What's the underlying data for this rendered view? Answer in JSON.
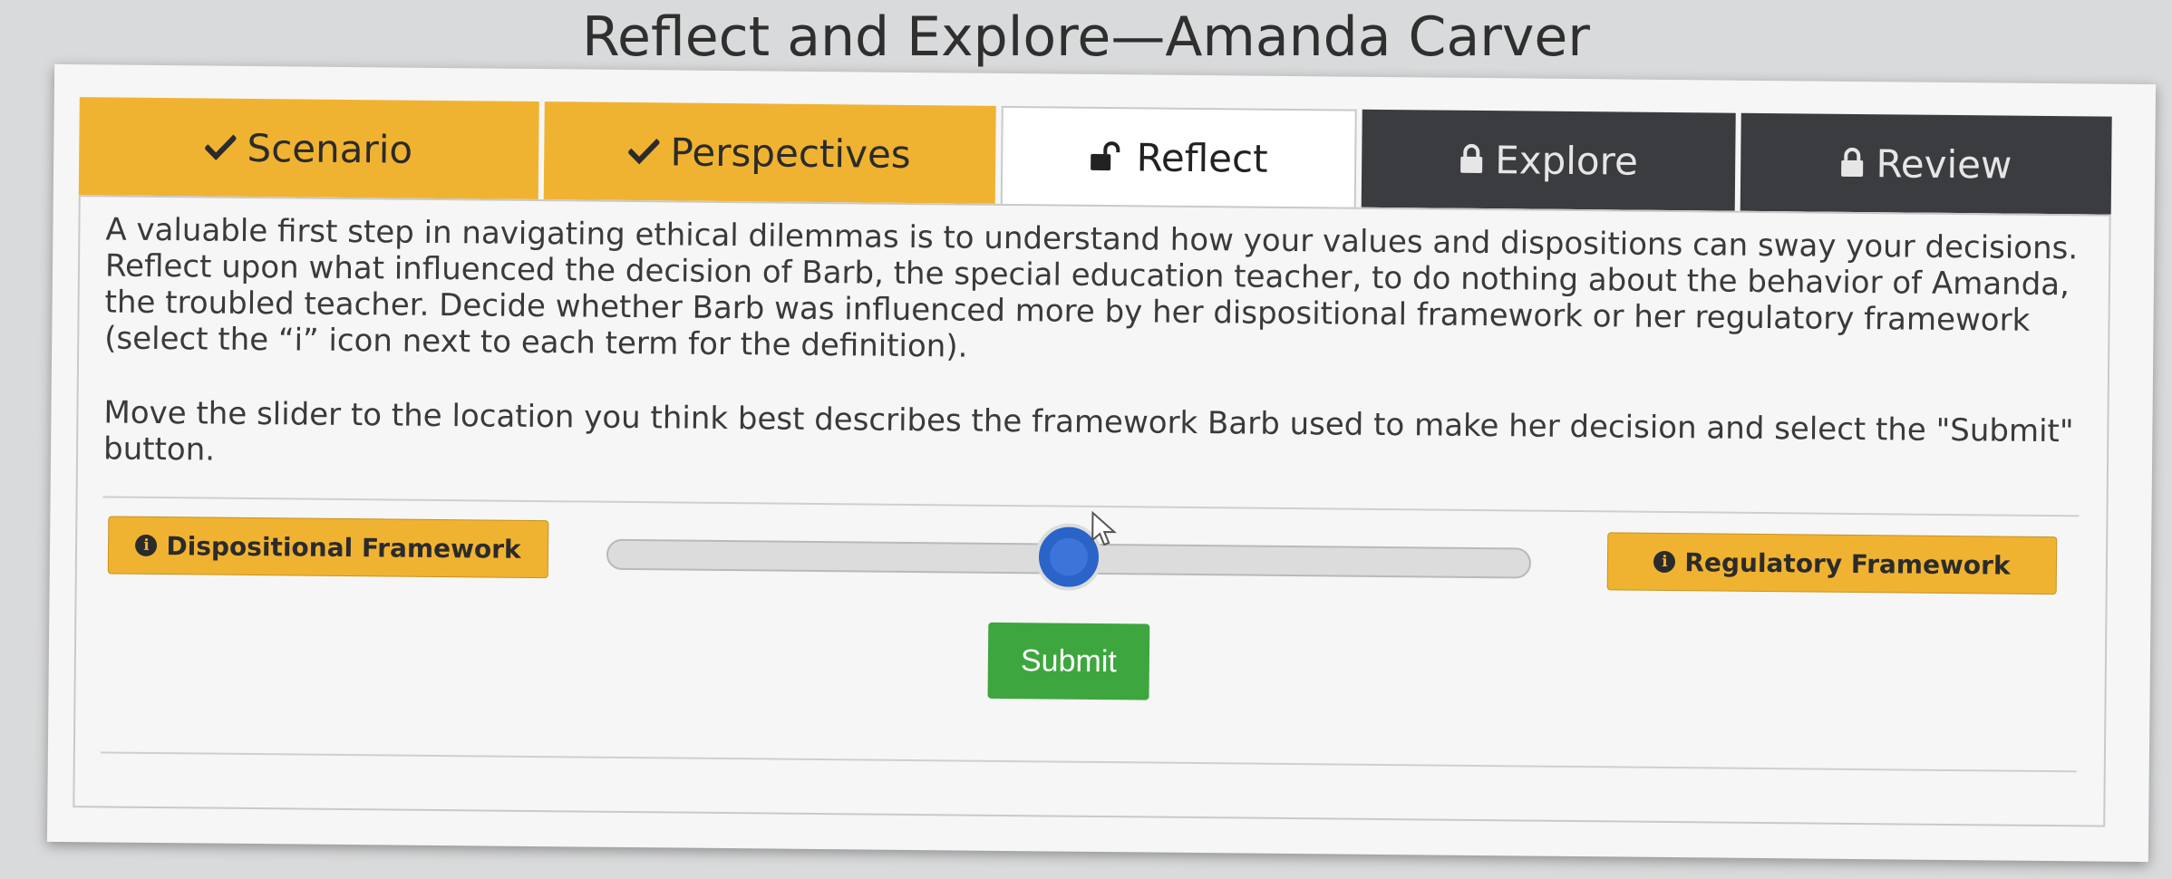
{
  "page": {
    "title": "Reflect and Explore—Amanda Carver"
  },
  "tabs": [
    {
      "label": "Scenario",
      "state": "completed",
      "icon": "check-icon"
    },
    {
      "label": "Perspectives",
      "state": "completed",
      "icon": "check-icon"
    },
    {
      "label": "Reflect",
      "state": "active",
      "icon": "unlock-icon"
    },
    {
      "label": "Explore",
      "state": "locked",
      "icon": "lock-icon"
    },
    {
      "label": "Review",
      "state": "locked",
      "icon": "lock-icon"
    }
  ],
  "instructions": {
    "paragraph1": "A valuable first step in navigating ethical dilemmas is to understand how your values and dispositions can sway your decisions. Reflect upon what influenced the decision of Barb, the special education teacher, to do nothing about the behavior of Amanda, the troubled teacher. Decide whether Barb was influenced more by her dispositional framework or her regulatory framework (select the “i” icon next to each term for the definition).",
    "paragraph2": "Move the slider to the location you think best describes the framework Barb used to make her decision and select the \"Submit\" button."
  },
  "slider": {
    "left_label": "Dispositional Framework",
    "right_label": "Regulatory Framework",
    "value": 0.5,
    "icon": "info-icon"
  },
  "submit": {
    "label": "Submit"
  },
  "colors": {
    "tab_completed": "#f0b331",
    "tab_locked": "#3b3c40",
    "slider_thumb": "#2a64c8",
    "submit": "#3ea63e",
    "framework_button": "#f0b331"
  }
}
